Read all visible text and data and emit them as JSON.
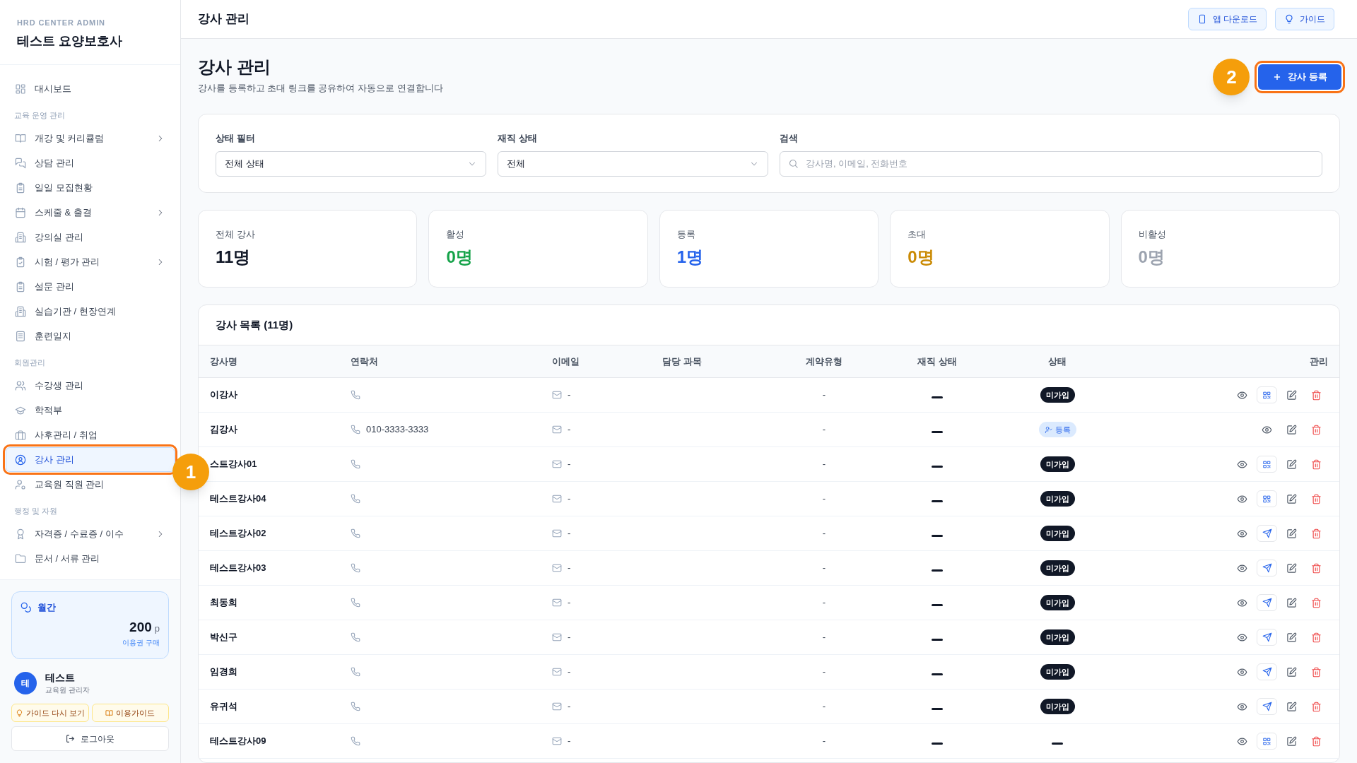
{
  "sidebar": {
    "brand_caption": "HRD CENTER ADMIN",
    "brand_title": "테스트 요양보호사",
    "nav": [
      {
        "kind": "item",
        "label": "대시보드",
        "expandable": false,
        "selected": false
      },
      {
        "kind": "section",
        "label": "교육 운영 관리"
      },
      {
        "kind": "item",
        "label": "개강 및 커리큘럼",
        "expandable": true,
        "selected": false
      },
      {
        "kind": "item",
        "label": "상담 관리",
        "expandable": false,
        "selected": false
      },
      {
        "kind": "item",
        "label": "일일 모집현황",
        "expandable": false,
        "selected": false
      },
      {
        "kind": "item",
        "label": "스케줄 & 출결",
        "expandable": true,
        "selected": false
      },
      {
        "kind": "item",
        "label": "강의실 관리",
        "expandable": false,
        "selected": false
      },
      {
        "kind": "item",
        "label": "시험 / 평가 관리",
        "expandable": true,
        "selected": false
      },
      {
        "kind": "item",
        "label": "설문 관리",
        "expandable": false,
        "selected": false
      },
      {
        "kind": "item",
        "label": "실습기관 / 현장연계",
        "expandable": false,
        "selected": false
      },
      {
        "kind": "item",
        "label": "훈련일지",
        "expandable": false,
        "selected": false
      },
      {
        "kind": "section",
        "label": "회원관리"
      },
      {
        "kind": "item",
        "label": "수강생 관리",
        "expandable": false,
        "selected": false
      },
      {
        "kind": "item",
        "label": "학적부",
        "expandable": false,
        "selected": false
      },
      {
        "kind": "item",
        "label": "사후관리 / 취업",
        "expandable": false,
        "selected": false
      },
      {
        "kind": "item",
        "label": "강사 관리",
        "expandable": false,
        "selected": true
      },
      {
        "kind": "item",
        "label": "교육원 직원 관리",
        "expandable": false,
        "selected": false
      },
      {
        "kind": "section",
        "label": "행정 및 자원"
      },
      {
        "kind": "item",
        "label": "자격증 / 수료증 / 이수",
        "expandable": true,
        "selected": false
      },
      {
        "kind": "item",
        "label": "문서 / 서류 관리",
        "expandable": false,
        "selected": false
      }
    ],
    "plan": {
      "label": "월간",
      "points": "200",
      "unit": "p",
      "link": "이용권 구매"
    },
    "user": {
      "avatar": "테",
      "name": "테스트",
      "role": "교육원 관리자"
    },
    "guide_buttons": [
      "가이드 다시 보기",
      "이용가이드"
    ],
    "logout": "로그아웃"
  },
  "header": {
    "title": "강사 관리",
    "buttons": [
      "앱 다운로드",
      "가이드"
    ]
  },
  "page": {
    "title": "강사 관리",
    "subtitle": "강사를 등록하고 초대 링크를 공유하여 자동으로 연결합니다",
    "add_button": "강사 등록"
  },
  "filters": [
    {
      "kind": "select",
      "label": "상태 필터",
      "value": "전체 상태"
    },
    {
      "kind": "select",
      "label": "재직 상태",
      "value": "전체"
    },
    {
      "kind": "search",
      "label": "검색",
      "placeholder": "강사명, 이메일, 전화번호"
    }
  ],
  "stats": [
    {
      "label": "전체 강사",
      "value": "11명",
      "color": "#111827"
    },
    {
      "label": "활성",
      "value": "0명",
      "color": "#16a34a"
    },
    {
      "label": "등록",
      "value": "1명",
      "color": "#2563eb"
    },
    {
      "label": "초대",
      "value": "0명",
      "color": "#ca8a04"
    },
    {
      "label": "비활성",
      "value": "0명",
      "color": "#9ca3af"
    }
  ],
  "table": {
    "title": "강사 목록 (11명)",
    "columns": [
      "강사명",
      "연락처",
      "이메일",
      "담당 과목",
      "계약유형",
      "재직 상태",
      "상태",
      "관리"
    ],
    "rows": [
      {
        "name": "이강사",
        "phone": "",
        "email": "-",
        "contract": "-",
        "status": {
          "kind": "unjoined",
          "label": "미가입"
        },
        "invite": {
          "kind": "qr"
        }
      },
      {
        "name": "김강사",
        "phone": "010-3333-3333",
        "email": "-",
        "contract": "-",
        "status": {
          "kind": "registered",
          "label": "등록"
        },
        "invite": {
          "kind": "none"
        }
      },
      {
        "name": "스트강사01",
        "phone": "",
        "email": "-",
        "contract": "-",
        "status": {
          "kind": "unjoined",
          "label": "미가입"
        },
        "invite": {
          "kind": "qr"
        }
      },
      {
        "name": "테스트강사04",
        "phone": "",
        "email": "-",
        "contract": "-",
        "status": {
          "kind": "unjoined",
          "label": "미가입"
        },
        "invite": {
          "kind": "qr"
        }
      },
      {
        "name": "테스트강사02",
        "phone": "",
        "email": "-",
        "contract": "-",
        "status": {
          "kind": "unjoined",
          "label": "미가입"
        },
        "invite": {
          "kind": "send"
        }
      },
      {
        "name": "테스트강사03",
        "phone": "",
        "email": "-",
        "contract": "-",
        "status": {
          "kind": "unjoined",
          "label": "미가입"
        },
        "invite": {
          "kind": "send"
        }
      },
      {
        "name": "최동희",
        "phone": "",
        "email": "-",
        "contract": "-",
        "status": {
          "kind": "unjoined",
          "label": "미가입"
        },
        "invite": {
          "kind": "send"
        }
      },
      {
        "name": "박신구",
        "phone": "",
        "email": "-",
        "contract": "-",
        "status": {
          "kind": "unjoined",
          "label": "미가입"
        },
        "invite": {
          "kind": "send"
        }
      },
      {
        "name": "임경희",
        "phone": "",
        "email": "-",
        "contract": "-",
        "status": {
          "kind": "unjoined",
          "label": "미가입"
        },
        "invite": {
          "kind": "send"
        }
      },
      {
        "name": "유귀석",
        "phone": "",
        "email": "-",
        "contract": "-",
        "status": {
          "kind": "unjoined",
          "label": "미가입"
        },
        "invite": {
          "kind": "send"
        }
      },
      {
        "name": "테스트강사09",
        "phone": "",
        "email": "-",
        "contract": "-",
        "status": {
          "kind": "none"
        },
        "invite": {
          "kind": "qr"
        }
      }
    ]
  },
  "annotations": [
    "1",
    "2"
  ]
}
